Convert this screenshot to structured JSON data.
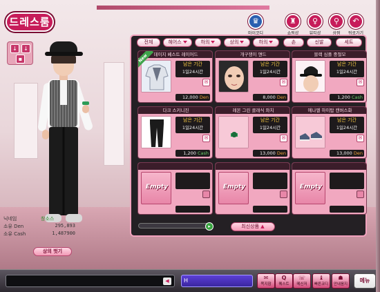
{
  "app": {
    "logo": "드레스룸"
  },
  "left_tools": {
    "btn1": "↓",
    "btn2": "↓",
    "btn3": "▪"
  },
  "top_icons": [
    {
      "label": "마이코디",
      "glyph": "♛",
      "color": "#2a5fb0"
    },
    {
      "label": "쇼핑샵",
      "glyph": "♜",
      "color": "#c71c5a"
    },
    {
      "label": "뷰티샵",
      "glyph": "♀",
      "color": "#c71c5a"
    },
    {
      "label": "상점",
      "glyph": "⚲",
      "color": "#c71c5a"
    },
    {
      "label": "뒤로가기",
      "glyph": "↶",
      "color": "#c71c5a"
    }
  ],
  "stats": {
    "name_label": "닉네임",
    "name_value": "창소스",
    "den_label": "소유 Den",
    "den_value": "295,893",
    "cash_label": "소유 Cash",
    "cash_value": "1,487900"
  },
  "top_wear_button": "상의 벗기",
  "tabs": [
    {
      "label": "전체",
      "dropdown": false
    },
    {
      "label": "헤어스",
      "dropdown": true
    },
    {
      "label": "하의",
      "dropdown": true
    },
    {
      "label": "상의",
      "dropdown": true
    },
    {
      "label": "하의",
      "dropdown": true
    },
    {
      "label": "손",
      "dropdown": false
    },
    {
      "label": "신발",
      "dropdown": false
    },
    {
      "label": "세트",
      "dropdown": false
    }
  ],
  "items": [
    {
      "title": "데이지 베스트 레이어드",
      "period_a": "남은 기간",
      "period_b": "1일24시간",
      "price": "12,000",
      "currency": "Den",
      "new_badge": "New",
      "thumb": "shirt"
    },
    {
      "title": "개구쟁이 얜드",
      "period_a": "남은 기간",
      "period_b": "1일24시간",
      "price": "8,000",
      "currency": "Den",
      "new_badge": "",
      "thumb": "face"
    },
    {
      "title": "블랙 심플 중절모",
      "period_a": "남은 기간",
      "period_b": "1일24시간",
      "price": "1,200",
      "currency": "Cash",
      "new_badge": "",
      "thumb": "hat"
    },
    {
      "title": "다크 스키니진",
      "period_a": "남은 기간",
      "period_b": "1일24시간",
      "price": "1,200",
      "currency": "Cash",
      "new_badge": "",
      "thumb": "pants"
    },
    {
      "title": "레몬 그린 클래식 와치",
      "period_a": "남은 기간",
      "period_b": "1일24시간",
      "price": "13,000",
      "currency": "Den",
      "new_badge": "",
      "thumb": "watch"
    },
    {
      "title": "에나멜 하이탑 캔버스화",
      "period_a": "남은 기간",
      "period_b": "1일24시간",
      "price": "13,000",
      "currency": "Den",
      "new_badge": "",
      "thumb": "shoes"
    }
  ],
  "empty_slots": [
    "Empty",
    "Empty",
    "Empty"
  ],
  "latest_button": "최신상품",
  "bottom": {
    "input_prefix": "H",
    "buttons": [
      {
        "icon": "✉",
        "label": "쪽지함"
      },
      {
        "icon": "Q",
        "label": "퀘스트"
      },
      {
        "icon": "☏",
        "label": "메신저"
      },
      {
        "icon": "♝",
        "label": "빠른코디"
      },
      {
        "icon": "☗",
        "label": "안내움지"
      }
    ],
    "menu": "메뉴"
  },
  "colors": {
    "accent": "#c71c5a",
    "den": "#f0a23a",
    "cash": "#6ad06a",
    "period": "#f6c842"
  }
}
